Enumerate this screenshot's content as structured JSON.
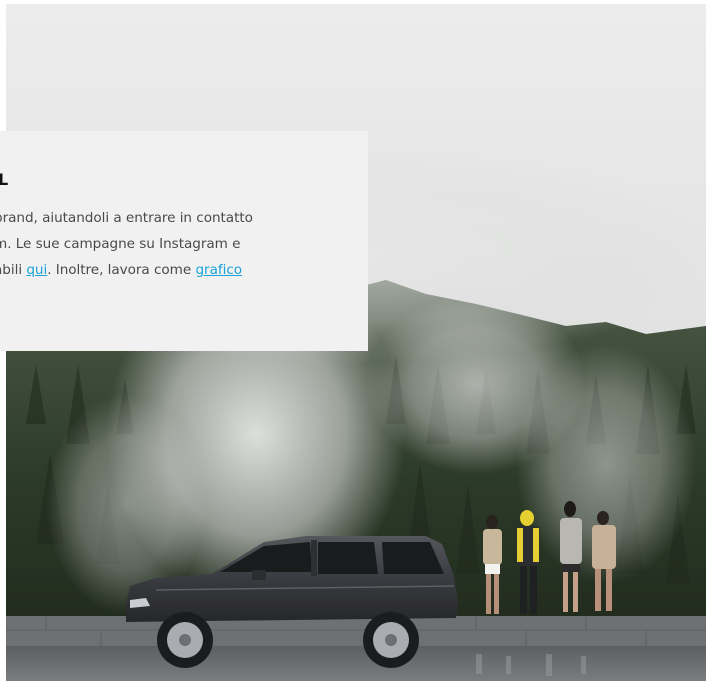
{
  "card": {
    "title_fragment": "L",
    "line1": "brand, aiutandoli a entrare in contatto",
    "line2": "m. Le sue campagne su Instagram e",
    "line3_before": "abili ",
    "line3_link1": "qui",
    "line3_middle": ". Inoltre, lavora come ",
    "line3_link2": "grafico "
  },
  "photo": {
    "subject": "foggy-forest-suv-people",
    "colors": {
      "sky": "#e9e9e9",
      "fog": "#dcdcdc",
      "forest_dark": "#23301f",
      "forest_mid": "#3f4d39",
      "car_body": "#3a3b3f",
      "road": "#6e7072",
      "wall": "#707274"
    }
  },
  "colors": {
    "card_background": "#f1f1f1",
    "link": "#1aa3d9",
    "body_text": "#4a4a4a",
    "title_text": "#111111"
  }
}
